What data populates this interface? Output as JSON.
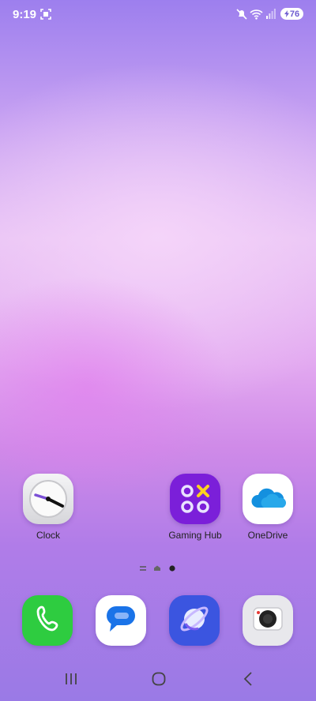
{
  "status_bar": {
    "time": "9:19",
    "battery_level": "76",
    "icons": [
      "screenshot-icon",
      "mute-icon",
      "wifi-icon",
      "signal-icon",
      "battery-charging-icon"
    ]
  },
  "home_apps": [
    {
      "name": "Clock",
      "icon": "clock-icon"
    },
    {
      "name": "Gaming Hub",
      "icon": "gaming-hub-icon"
    },
    {
      "name": "OneDrive",
      "icon": "onedrive-icon"
    }
  ],
  "page_indicator": {
    "pages": 3,
    "current": 3
  },
  "dock": [
    {
      "icon": "phone-icon",
      "color": "#2ecc40"
    },
    {
      "icon": "messages-icon",
      "color": "#ffffff"
    },
    {
      "icon": "internet-icon",
      "color": "#3b55e0"
    },
    {
      "icon": "camera-icon",
      "color": "#e8e8ec"
    }
  ],
  "nav_bar": [
    "recents-icon",
    "home-icon",
    "back-icon"
  ]
}
